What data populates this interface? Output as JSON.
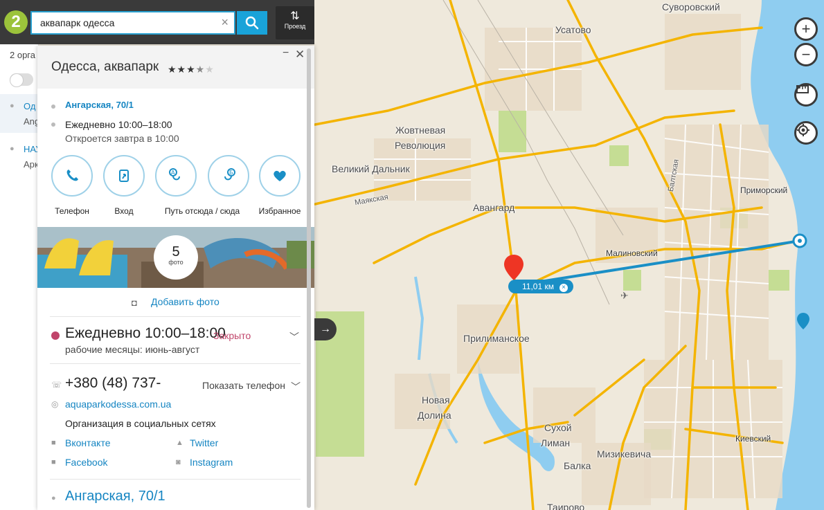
{
  "header": {
    "logo": "2",
    "search_value": "аквапарк одесса",
    "search_clear": "×",
    "route_label": "Проезд"
  },
  "list": {
    "count_text": "2 орга",
    "items": [
      {
        "title": "Од",
        "subtitle": "Ang"
      },
      {
        "title": "НАУ",
        "subtitle": "Арк"
      }
    ]
  },
  "card": {
    "title": "Одесса, аквапарк",
    "rating_stars": "★★★",
    "rating_half": "★",
    "rating_empty": "★",
    "minimize": "−",
    "close": "✕",
    "address": "Ангарская, 70/1",
    "schedule": "Ежедневно 10:00–18:00",
    "opens": "Откроется завтра в 10:00",
    "actions": [
      {
        "label": "Телефон",
        "icon": "phone-icon"
      },
      {
        "label": "Вход",
        "icon": "entrance-icon"
      },
      {
        "label": "Путь отсюда / сюда",
        "icon": "route-ab-icon"
      },
      {
        "label": "Избранное",
        "icon": "heart-icon"
      }
    ],
    "photos": {
      "count": "5",
      "word": "фото"
    },
    "add_photo": "Добавить фото",
    "hours": {
      "main": "Ежедневно 10:00–18:00",
      "status": "Закрыто",
      "note": "рабочие месяцы: июнь-август"
    },
    "phone": "+380 (48) 737-",
    "show_phone": "Показать телефон",
    "website": "aquaparkodessa.com.ua",
    "social_heading": "Организация в социальных сетях",
    "social": {
      "vk": "Вконтакте",
      "twitter": "Twitter",
      "facebook": "Facebook",
      "instagram": "Instagram"
    },
    "address_bottom": "Ангарская, 70/1"
  },
  "map": {
    "labels": {
      "suvorovsky": "Суворовский",
      "usatovo": "Усатово",
      "zhovtneva": "Жовтневая",
      "revolyutsiya": "Революция",
      "velikiy_dalnik": "Великий Дальник",
      "mayakskaya": "Маякская",
      "avangard": "Авангард",
      "primorsky": "Приморский",
      "baltskaya": "Балтская",
      "malinovsky": "Малиновский",
      "prilimanskoe": "Прилиманское",
      "novaya": "Новая",
      "dolina": "Долина",
      "sukhoy": "Сухой",
      "liman": "Лиман",
      "balka": "Балка",
      "mizikevicha": "Мизикевича",
      "kievsky": "Киевский",
      "tairovo": "Таирово"
    },
    "distance": "11,01 км",
    "distance_clear": "×",
    "zoom_in": "+",
    "zoom_out": "−",
    "ruler_icon": "ruler-icon",
    "locate_icon": "locate-icon"
  },
  "colors": {
    "accent": "#1a8fc6",
    "road_major": "#f4b400",
    "water": "#8fcdf0",
    "park": "#c5dd94",
    "closed": "#c0446a"
  }
}
